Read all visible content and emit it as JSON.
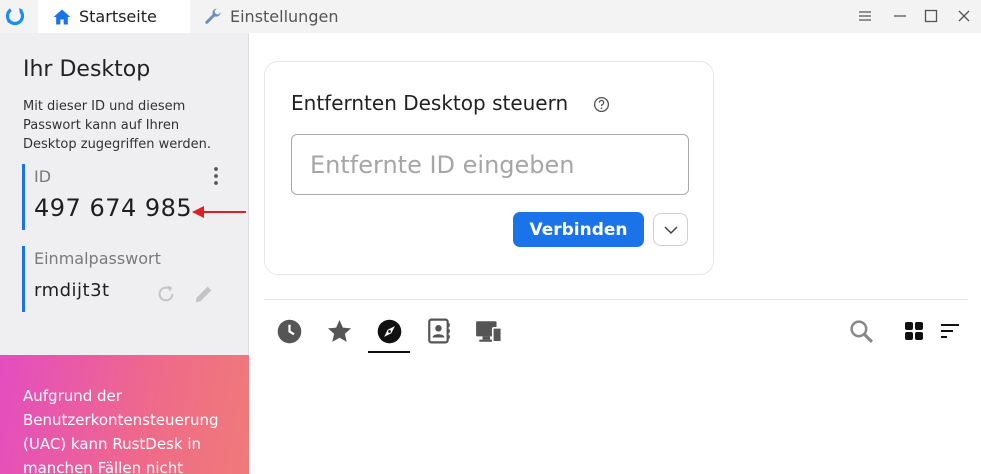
{
  "titlebar": {
    "tabs": [
      {
        "label": "Startseite",
        "icon": "home-icon"
      },
      {
        "label": "Einstellungen",
        "icon": "wrench-icon"
      }
    ]
  },
  "left_panel": {
    "title": "Ihr Desktop",
    "description": "Mit dieser ID und diesem Passwort kann auf Ihren Desktop zugegriffen werden.",
    "id_label": "ID",
    "id_value": "497 674 985",
    "password_label": "Einmalpasswort",
    "password_value": "rmdijt3t",
    "uac_notice": "Aufgrund der Benutzerkontensteuerung (UAC) kann RustDesk in manchen Fällen nicht"
  },
  "connect_card": {
    "title": "Entfernten Desktop steuern",
    "input_placeholder": "Entfernte ID eingeben",
    "input_value": "",
    "connect_label": "Verbinden"
  },
  "peer_tabs": [
    {
      "icon": "history-icon"
    },
    {
      "icon": "star-icon"
    },
    {
      "icon": "compass-icon",
      "active": true
    },
    {
      "icon": "address-book-icon"
    },
    {
      "icon": "devices-icon"
    }
  ],
  "colors": {
    "accent": "#1a73e8",
    "sidebar_bg": "#efeff1",
    "uac_gradient_start": "#e34dc0",
    "uac_gradient_end": "#f07a78",
    "annotation_arrow": "#e02020"
  }
}
